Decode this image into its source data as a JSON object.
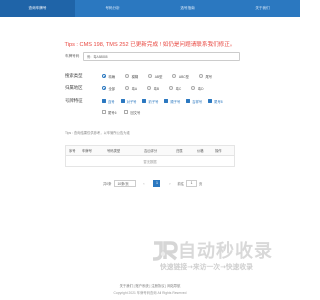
{
  "nav": {
    "tabs": [
      {
        "label": "查询车牌号"
      },
      {
        "label": "号码分析"
      },
      {
        "label": "选号指南"
      },
      {
        "label": "关于我们"
      }
    ]
  },
  "tips": "Tips : CMS 198, TMS 252 已更新完成 ! 如仍是问题请联系我们修正。",
  "search": {
    "label": "车牌号码",
    "placeholder": "例：粤A88888"
  },
  "plate_type": {
    "label": "搜索类型",
    "options": [
      {
        "label": "精确",
        "checked": true
      },
      {
        "label": "模糊",
        "checked": false
      },
      {
        "label": "AB型",
        "checked": false
      },
      {
        "label": "ABC型",
        "checked": false
      },
      {
        "label": "尾号",
        "checked": false
      }
    ]
  },
  "region": {
    "label": "归属地区",
    "options": [
      {
        "label": "全部",
        "checked": true
      },
      {
        "label": "粤A",
        "checked": false
      },
      {
        "label": "粤B",
        "checked": false
      },
      {
        "label": "粤C",
        "checked": false
      },
      {
        "label": "粤D",
        "checked": false
      }
    ]
  },
  "feature": {
    "label": "号牌特征",
    "options": [
      {
        "label": "连号",
        "checked": true
      },
      {
        "label": "对子号",
        "checked": true
      },
      {
        "label": "豹子号",
        "checked": true
      },
      {
        "label": "顺子号",
        "checked": true
      },
      {
        "label": "吉祥号",
        "checked": true
      },
      {
        "label": "尾号8",
        "checked": true
      }
    ],
    "options2": [
      {
        "label": "尾号6",
        "checked": false
      },
      {
        "label": "回文号",
        "checked": false
      }
    ]
  },
  "note": "Tips : 查询结果仅供参考，以车管所公告为准",
  "table": {
    "headers": [
      "序号",
      "车牌号",
      "号码类型",
      "吉凶评分",
      "归属",
      "价格",
      "操作"
    ],
    "empty_text": "暂无数据"
  },
  "pager": {
    "total_label": "共0条",
    "page_size": "10条/页",
    "current_page": "1",
    "goto_label": "前往",
    "goto_value": "1",
    "page_suffix": "页"
  },
  "logo": {
    "text": "自动秒收录",
    "sub": "快速链接→来访一次→快速收录"
  },
  "footer": {
    "links": "关于我们 | 账户系统 | 注册协议 | 网站导航",
    "copyright": "Copyright 2021 车牌号码查询 All Rights Reserved"
  },
  "colors": {
    "accent": "#2b78c0",
    "tips": "#e8463f"
  }
}
